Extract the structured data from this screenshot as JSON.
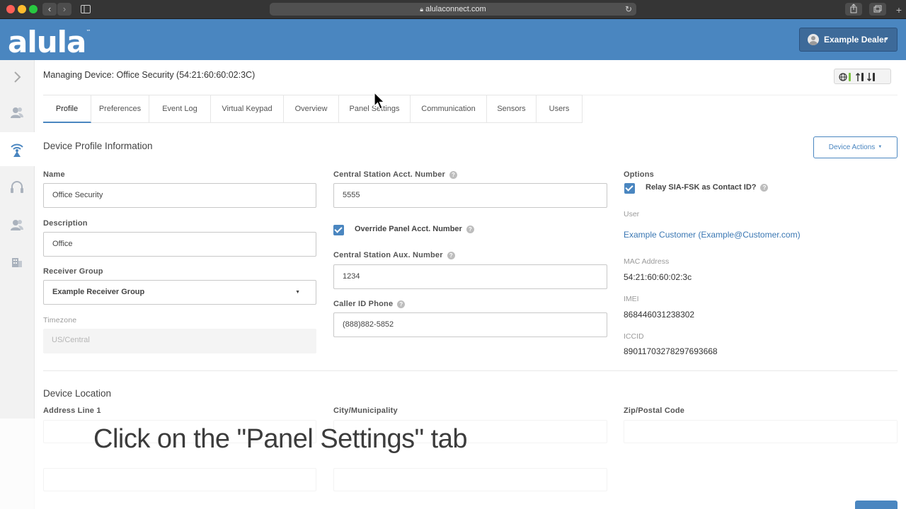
{
  "browser": {
    "url": "alulaconnect.com",
    "back_icon": "chevron-left-icon",
    "forward_icon": "chevron-right-icon"
  },
  "header": {
    "logo": "alula",
    "logo_tm": "™",
    "user_menu_label": "Example Dealer",
    "brand_color": "#4a86c0"
  },
  "left_nav": {
    "items": [
      {
        "icon": "chevron-right-icon"
      },
      {
        "icon": "users-icon"
      },
      {
        "icon": "antenna-icon",
        "active": true
      },
      {
        "icon": "headset-icon"
      },
      {
        "icon": "user-group-icon"
      },
      {
        "icon": "building-icon"
      }
    ]
  },
  "page": {
    "managing_device": "Managing Device: Office Security (54:21:60:60:02:3C)"
  },
  "tabs": [
    {
      "label": "Profile",
      "active": true
    },
    {
      "label": "Preferences"
    },
    {
      "label": "Event Log"
    },
    {
      "label": "Virtual Keypad"
    },
    {
      "label": "Overview"
    },
    {
      "label": "Panel Settings"
    },
    {
      "label": "Communication"
    },
    {
      "label": "Sensors"
    },
    {
      "label": "Users"
    }
  ],
  "profile": {
    "section_title": "Device Profile Information",
    "device_actions_label": "Device Actions",
    "name_label": "Name",
    "name_value": "Office Security",
    "description_label": "Description",
    "description_value": "Office",
    "receiver_group_label": "Receiver Group",
    "receiver_group_value": "Example Receiver Group",
    "timezone_label": "Timezone",
    "timezone_value": "US/Central",
    "cs_acct_label": "Central Station Acct. Number",
    "cs_acct_value": "5555",
    "override_label": "Override Panel Acct. Number",
    "override_checked": true,
    "cs_aux_label": "Central Station Aux. Number",
    "cs_aux_value": "1234",
    "caller_id_label": "Caller ID Phone",
    "caller_id_value": "(888)882-5852",
    "options_label": "Options",
    "relay_label": "Relay SIA-FSK as Contact ID?",
    "relay_checked": true,
    "user_label": "User",
    "user_value": "Example Customer (Example@Customer.com)",
    "mac_label": "MAC Address",
    "mac_value": "54:21:60:60:02:3c",
    "imei_label": "IMEI",
    "imei_value": "868446031238302",
    "iccid_label": "ICCID",
    "iccid_value": "89011703278297693668"
  },
  "location": {
    "section_title": "Device Location",
    "address1_label": "Address Line 1",
    "city_label": "City/Municipality",
    "zip_label": "Zip/Postal Code"
  },
  "caption": "Click on the \"Panel Settings\" tab"
}
